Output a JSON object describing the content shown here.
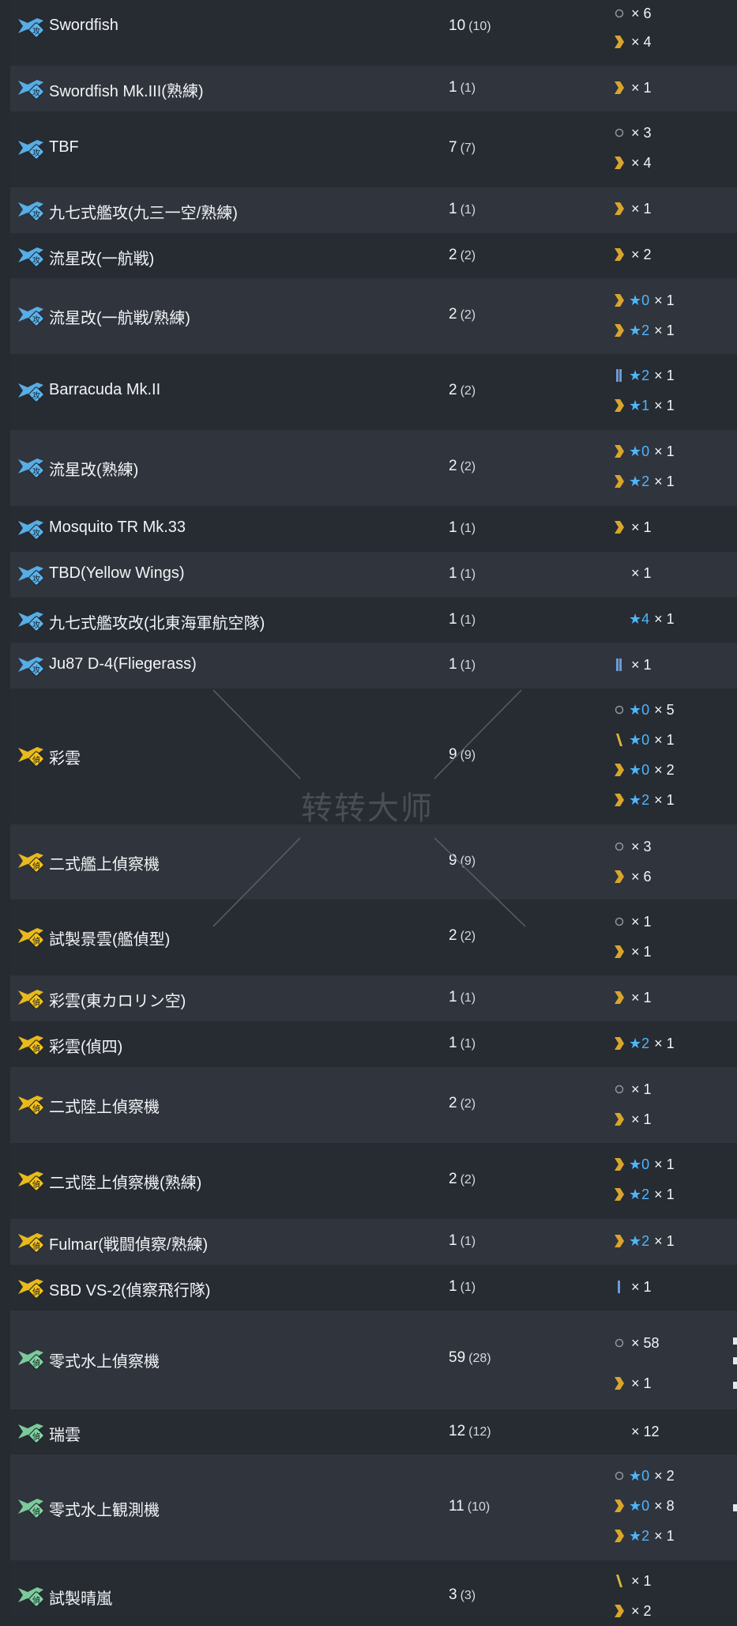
{
  "icon_colors": {
    "attack": "#5ab4ee",
    "recon_yellow": "#f2c21a",
    "recon_green": "#7fd3a0"
  },
  "icon_labels": {
    "attack": "攻",
    "recon": "偵"
  },
  "watermark": "转转大师",
  "rows": [
    {
      "name": "Swordfish",
      "count": "10",
      "sub": "(10)",
      "icon": "attack",
      "prof": [
        {
          "type": "circle",
          "star": "",
          "mult": "× 6"
        },
        {
          "type": "chevron",
          "star": "",
          "mult": "× 4"
        }
      ]
    },
    {
      "name": "Swordfish Mk.III(熟練)",
      "count": "1",
      "sub": "(1)",
      "icon": "attack",
      "prof": [
        {
          "type": "chevron",
          "star": "",
          "mult": "× 1"
        }
      ]
    },
    {
      "name": "TBF",
      "count": "7",
      "sub": "(7)",
      "icon": "attack",
      "prof": [
        {
          "type": "circle",
          "star": "",
          "mult": "× 3"
        },
        {
          "type": "chevron",
          "star": "",
          "mult": "× 4"
        }
      ]
    },
    {
      "name": "九七式艦攻(九三一空/熟練)",
      "count": "1",
      "sub": "(1)",
      "icon": "attack",
      "prof": [
        {
          "type": "chevron",
          "star": "",
          "mult": "× 1"
        }
      ]
    },
    {
      "name": "流星改(一航戦)",
      "count": "2",
      "sub": "(2)",
      "icon": "attack",
      "prof": [
        {
          "type": "chevron",
          "star": "",
          "mult": "× 2"
        }
      ]
    },
    {
      "name": "流星改(一航戦/熟練)",
      "count": "2",
      "sub": "(2)",
      "icon": "attack",
      "prof": [
        {
          "type": "chevron",
          "star": "0",
          "mult": "× 1"
        },
        {
          "type": "chevron",
          "star": "2",
          "mult": "× 1"
        }
      ]
    },
    {
      "name": "Barracuda Mk.II",
      "count": "2",
      "sub": "(2)",
      "icon": "attack",
      "prof": [
        {
          "type": "bars",
          "star": "2",
          "mult": "× 1"
        },
        {
          "type": "chevron",
          "star": "1",
          "mult": "× 1"
        }
      ]
    },
    {
      "name": "流星改(熟練)",
      "count": "2",
      "sub": "(2)",
      "icon": "attack",
      "prof": [
        {
          "type": "chevron",
          "star": "0",
          "mult": "× 1"
        },
        {
          "type": "chevron",
          "star": "2",
          "mult": "× 1"
        }
      ]
    },
    {
      "name": "Mosquito TR Mk.33",
      "count": "1",
      "sub": "(1)",
      "icon": "attack",
      "prof": [
        {
          "type": "chevron",
          "star": "",
          "mult": "× 1"
        }
      ]
    },
    {
      "name": "TBD(Yellow Wings)",
      "count": "1",
      "sub": "(1)",
      "icon": "attack",
      "prof": [
        {
          "type": "none",
          "star": "",
          "mult": "× 1"
        }
      ]
    },
    {
      "name": "九七式艦攻改(北東海軍航空隊)",
      "count": "1",
      "sub": "(1)",
      "icon": "attack",
      "prof": [
        {
          "type": "none",
          "star": "4",
          "mult": "× 1"
        }
      ]
    },
    {
      "name": "Ju87 D-4(Fliegerass)",
      "count": "1",
      "sub": "(1)",
      "icon": "attack",
      "prof": [
        {
          "type": "bars",
          "star": "",
          "mult": "× 1"
        }
      ]
    },
    {
      "name": "彩雲",
      "count": "9",
      "sub": "(9)",
      "icon": "recon_yellow",
      "prof": [
        {
          "type": "circle",
          "star": "0",
          "mult": "× 5"
        },
        {
          "type": "slash",
          "star": "0",
          "mult": "× 1"
        },
        {
          "type": "chevron",
          "star": "0",
          "mult": "× 2"
        },
        {
          "type": "chevron",
          "star": "2",
          "mult": "× 1"
        }
      ]
    },
    {
      "name": "二式艦上偵察機",
      "count": "9",
      "sub": "(9)",
      "icon": "recon_yellow",
      "prof": [
        {
          "type": "circle",
          "star": "",
          "mult": "× 3"
        },
        {
          "type": "chevron",
          "star": "",
          "mult": "× 6"
        }
      ]
    },
    {
      "name": "試製景雲(艦偵型)",
      "count": "2",
      "sub": "(2)",
      "icon": "recon_yellow",
      "prof": [
        {
          "type": "circle",
          "star": "",
          "mult": "× 1"
        },
        {
          "type": "chevron",
          "star": "",
          "mult": "× 1"
        }
      ]
    },
    {
      "name": "彩雲(東カロリン空)",
      "count": "1",
      "sub": "(1)",
      "icon": "recon_yellow",
      "prof": [
        {
          "type": "chevron",
          "star": "",
          "mult": "× 1"
        }
      ]
    },
    {
      "name": "彩雲(偵四)",
      "count": "1",
      "sub": "(1)",
      "icon": "recon_yellow",
      "prof": [
        {
          "type": "chevron",
          "star": "2",
          "mult": "× 1"
        }
      ]
    },
    {
      "name": "二式陸上偵察機",
      "count": "2",
      "sub": "(2)",
      "icon": "recon_yellow",
      "prof": [
        {
          "type": "circle",
          "star": "",
          "mult": "× 1"
        },
        {
          "type": "chevron",
          "star": "",
          "mult": "× 1"
        }
      ]
    },
    {
      "name": "二式陸上偵察機(熟練)",
      "count": "2",
      "sub": "(2)",
      "icon": "recon_yellow",
      "prof": [
        {
          "type": "chevron",
          "star": "0",
          "mult": "× 1"
        },
        {
          "type": "chevron",
          "star": "2",
          "mult": "× 1"
        }
      ]
    },
    {
      "name": "Fulmar(戦闘偵察/熟練)",
      "count": "1",
      "sub": "(1)",
      "icon": "recon_yellow",
      "prof": [
        {
          "type": "chevron",
          "star": "2",
          "mult": "× 1"
        }
      ]
    },
    {
      "name": "SBD VS-2(偵察飛行隊)",
      "count": "1",
      "sub": "(1)",
      "icon": "recon_yellow",
      "prof": [
        {
          "type": "bar",
          "star": "",
          "mult": "× 1"
        }
      ]
    },
    {
      "name": "零式水上偵察機",
      "count": "59",
      "sub": "(28)",
      "icon": "recon_green",
      "prof": [
        {
          "type": "circle",
          "star": "",
          "mult": "× 58"
        },
        {
          "type": "chevron",
          "star": "",
          "mult": "× 1"
        }
      ]
    },
    {
      "name": "瑞雲",
      "count": "12",
      "sub": "(12)",
      "icon": "recon_green",
      "prof": [
        {
          "type": "none",
          "star": "",
          "mult": "× 12"
        }
      ]
    },
    {
      "name": "零式水上観測機",
      "count": "11",
      "sub": "(10)",
      "icon": "recon_green",
      "prof": [
        {
          "type": "circle",
          "star": "0",
          "mult": "× 2"
        },
        {
          "type": "chevron",
          "star": "0",
          "mult": "× 8"
        },
        {
          "type": "chevron",
          "star": "2",
          "mult": "× 1"
        }
      ]
    },
    {
      "name": "試製晴嵐",
      "count": "3",
      "sub": "(3)",
      "icon": "recon_green",
      "prof": [
        {
          "type": "slash",
          "star": "",
          "mult": "× 1"
        },
        {
          "type": "chevron",
          "star": "",
          "mult": "× 2"
        }
      ]
    }
  ]
}
